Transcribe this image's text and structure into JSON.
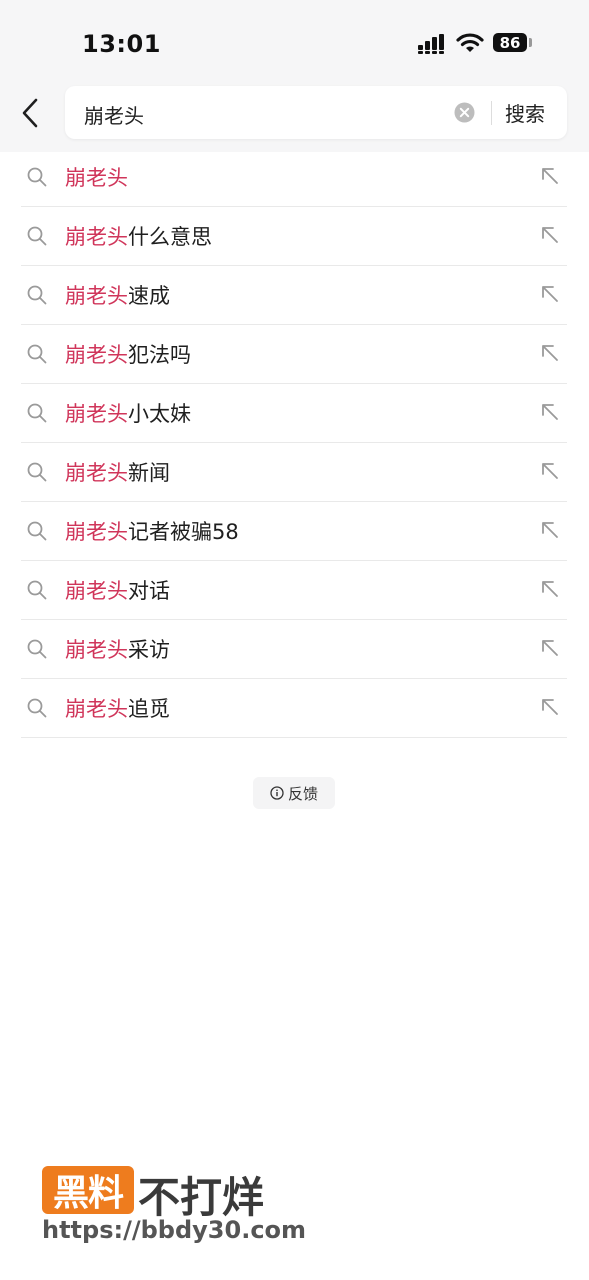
{
  "status_bar": {
    "time": "13:01",
    "battery": "86",
    "icons": [
      "signal-icon",
      "wifi-icon",
      "battery-icon"
    ]
  },
  "search": {
    "query": "崩老头",
    "button_label": "搜索",
    "icons": [
      "back-icon",
      "clear-icon"
    ]
  },
  "suggestions": [
    {
      "highlight": "崩老头",
      "rest": ""
    },
    {
      "highlight": "崩老头",
      "rest": "什么意思"
    },
    {
      "highlight": "崩老头",
      "rest": "速成"
    },
    {
      "highlight": "崩老头",
      "rest": "犯法吗"
    },
    {
      "highlight": "崩老头",
      "rest": "小太妹"
    },
    {
      "highlight": "崩老头",
      "rest": "新闻"
    },
    {
      "highlight": "崩老头",
      "rest": "记者被骗58"
    },
    {
      "highlight": "崩老头",
      "rest": "对话"
    },
    {
      "highlight": "崩老头",
      "rest": "采访"
    },
    {
      "highlight": "崩老头",
      "rest": "追觅"
    }
  ],
  "feedback": {
    "label": "反馈",
    "icon": "info-icon"
  },
  "watermark": {
    "badge": "黑料",
    "title": "不打烊",
    "url": "https://bbdy30.com"
  },
  "colors": {
    "highlight": "#d0355a",
    "badge": "#ee7c1e"
  }
}
